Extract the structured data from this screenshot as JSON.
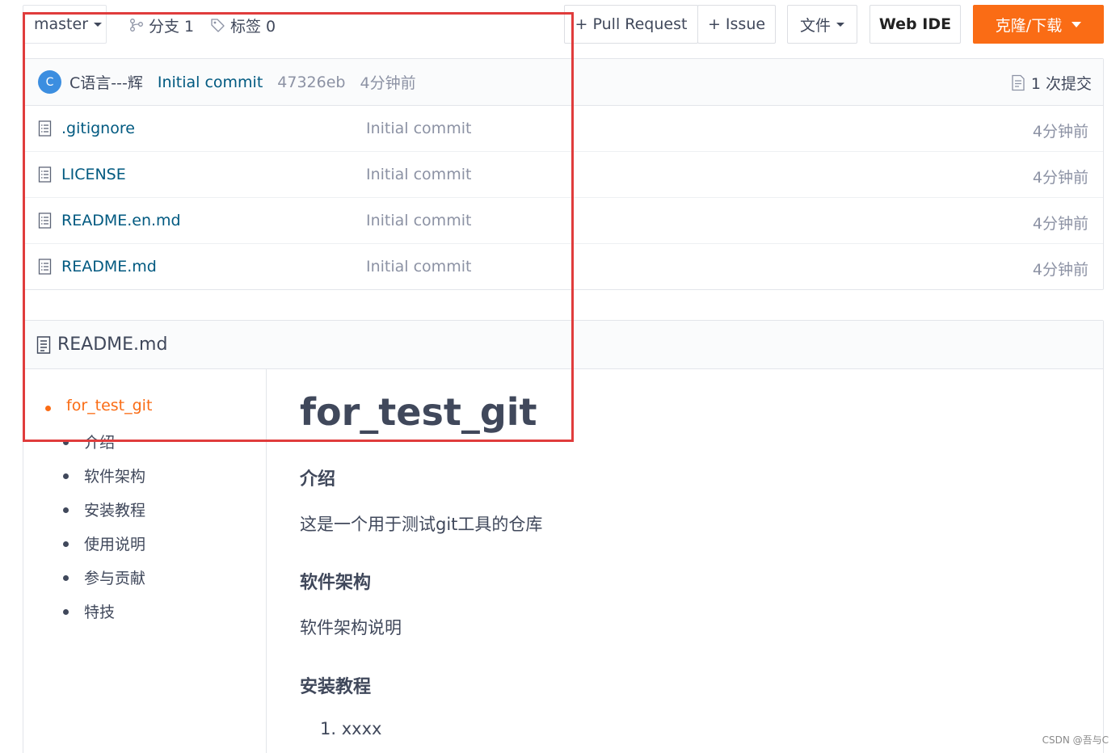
{
  "toolbar": {
    "branch": "master",
    "branches_label": "分支 1",
    "tags_label": "标签 0",
    "pull_request_label": "+ Pull Request",
    "issue_label": "+ Issue",
    "files_label": "文件",
    "web_ide_label": "Web IDE",
    "clone_label": "克隆/下载"
  },
  "commit_bar": {
    "avatar_letter": "C",
    "author": "C语言---辉",
    "message": "Initial commit",
    "hash": "47326eb",
    "time": "4分钟前",
    "commit_count": "1 次提交"
  },
  "files": [
    {
      "name": ".gitignore",
      "commit": "Initial commit",
      "time": "4分钟前"
    },
    {
      "name": "LICENSE",
      "commit": "Initial commit",
      "time": "4分钟前"
    },
    {
      "name": "README.en.md",
      "commit": "Initial commit",
      "time": "4分钟前"
    },
    {
      "name": "README.md",
      "commit": "Initial commit",
      "time": "4分钟前"
    }
  ],
  "readme": {
    "filename": "README.md",
    "toc": [
      "for_test_git",
      "介绍",
      "软件架构",
      "安装教程",
      "使用说明",
      "参与贡献",
      "特技"
    ],
    "title": "for_test_git",
    "intro_heading": "介绍",
    "intro_text": "这是一个用于测试git工具的仓库",
    "arch_heading": "软件架构",
    "arch_text": "软件架构说明",
    "install_heading": "安装教程",
    "install_first_item": "1. xxxx"
  },
  "watermark": "CSDN @吾与C",
  "colors": {
    "accent": "#fa6c15",
    "link": "#005980",
    "muted": "#8c92a4",
    "annotation_box": "#e03c3c"
  }
}
